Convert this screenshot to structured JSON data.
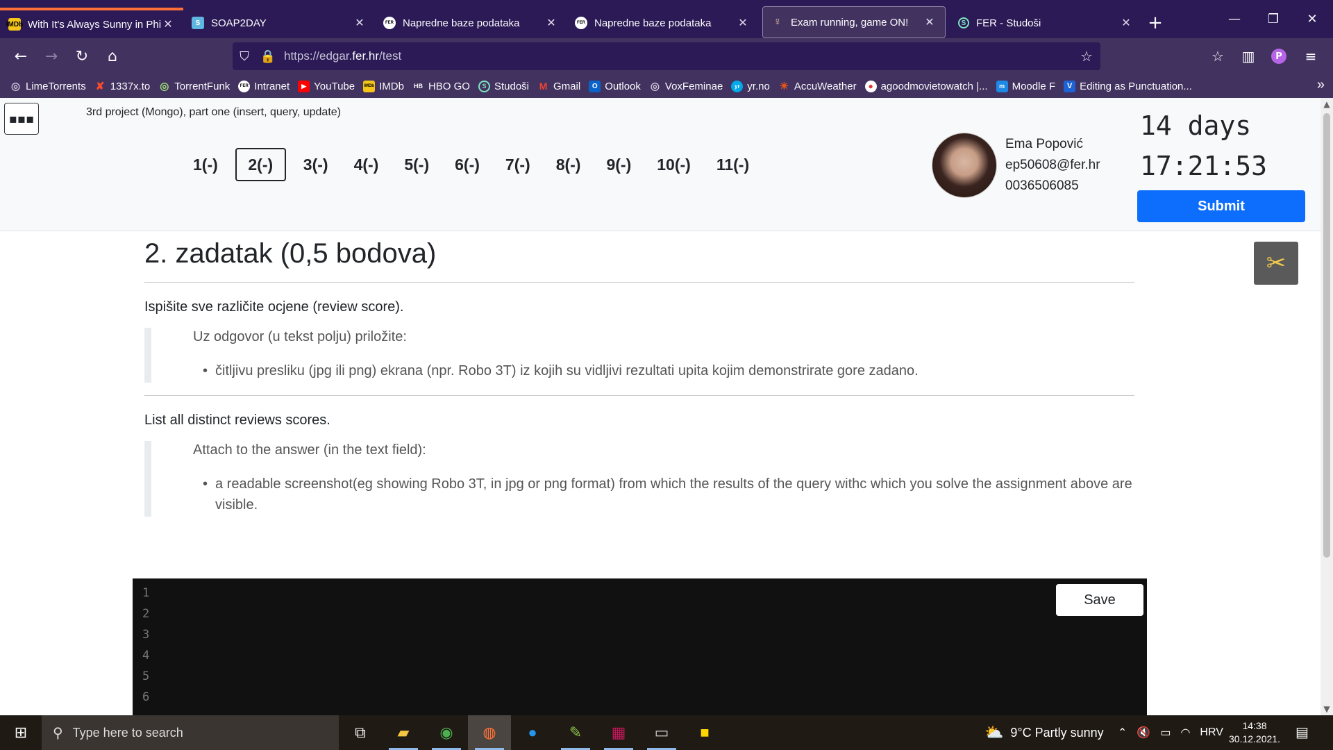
{
  "browser": {
    "tabs": [
      {
        "title": "With It's Always Sunny in Philac",
        "favicon": "imdb-icon",
        "favicon_text": "IMDb"
      },
      {
        "title": "SOAP2DAY",
        "favicon": "soap2day-icon",
        "favicon_text": "S"
      },
      {
        "title": "Napredne baze podataka",
        "favicon": "fer-icon",
        "favicon_text": "FER"
      },
      {
        "title": "Napredne baze podataka",
        "favicon": "fer-icon",
        "favicon_text": "FER"
      },
      {
        "title": "Exam running, game ON!",
        "favicon": "exam-icon",
        "favicon_text": "♀"
      },
      {
        "title": "FER - Studoši",
        "favicon": "studosi-icon",
        "favicon_text": "S"
      }
    ],
    "url_prefix": "https://edgar.",
    "url_domain": "fer.hr",
    "url_path": "/test",
    "bookmarks": [
      {
        "label": "LimeTorrents",
        "color": "#c7c2d7",
        "glyph": "◎"
      },
      {
        "label": "1337x.to",
        "color": "#ff4c2b",
        "glyph": "X"
      },
      {
        "label": "TorrentFunk",
        "color": "#9fdc7a",
        "glyph": "◎"
      },
      {
        "label": "Intranet",
        "color": "#ffffff",
        "glyph": "FER"
      },
      {
        "label": "YouTube",
        "color": "#ff0000",
        "glyph": "▶"
      },
      {
        "label": "IMDb",
        "color": "#f5c518",
        "glyph": "IMDb"
      },
      {
        "label": "HBO GO",
        "color": "#ffffff",
        "glyph": "HB"
      },
      {
        "label": "Studoši",
        "color": "#7fe3c0",
        "glyph": "S"
      },
      {
        "label": "Gmail",
        "color": "#ea4335",
        "glyph": "M"
      },
      {
        "label": "Outlook",
        "color": "#0a64c8",
        "glyph": "O"
      },
      {
        "label": "VoxFeminae",
        "color": "#c7c2d7",
        "glyph": "◎"
      },
      {
        "label": "yr.no",
        "color": "#00a8e8",
        "glyph": "yr"
      },
      {
        "label": "AccuWeather",
        "color": "#f05514",
        "glyph": "☀"
      },
      {
        "label": "agoodmovietowatch |...",
        "color": "#e03535",
        "glyph": "●"
      },
      {
        "label": "Moodle F",
        "color": "#1e88e5",
        "glyph": "m"
      },
      {
        "label": "Editing as Punctuation...",
        "color": "#1e63d6",
        "glyph": "V"
      }
    ]
  },
  "exam": {
    "title": "3rd project (Mongo), part one (insert, query, update)",
    "questions": [
      "1(-)",
      "2(-)",
      "3(-)",
      "4(-)",
      "5(-)",
      "6(-)",
      "7(-)",
      "8(-)",
      "9(-)",
      "10(-)",
      "11(-)"
    ],
    "active_question": "2(-)",
    "student": {
      "name": "Ema Popović",
      "email": "ep50608@fer.hr",
      "id": "0036506085"
    },
    "timer_days": "14 days",
    "timer_clock": "17:21:53",
    "submit_label": "Submit"
  },
  "task": {
    "heading": "2. zadatak (0,5 bodova)",
    "text_hr": "Ispišite sve različite ocjene (review score).",
    "attach_hr": "Uz odgovor (u tekst polju) priložite:",
    "bullet_hr": "čitljivu presliku (jpg ili png) ekrana (npr. Robo 3T) iz kojih su vidljivi rezultati upita kojim demonstrirate gore zadano.",
    "text_en": "List all distinct reviews scores.",
    "attach_en": "Attach to the answer (in the text field):",
    "bullet_en": "a readable screenshot(eg showing Robo 3T, in jpg or png format) from which the results of the query withc which you solve the assignment above are visible."
  },
  "editor": {
    "line_numbers": [
      "1",
      "2",
      "3",
      "4",
      "5",
      "6"
    ],
    "save_label": "Save"
  },
  "taskbar": {
    "search_placeholder": "Type here to search",
    "weather": "9°C  Partly sunny",
    "language": "HRV",
    "time": "14:38",
    "date": "30.12.2021."
  }
}
